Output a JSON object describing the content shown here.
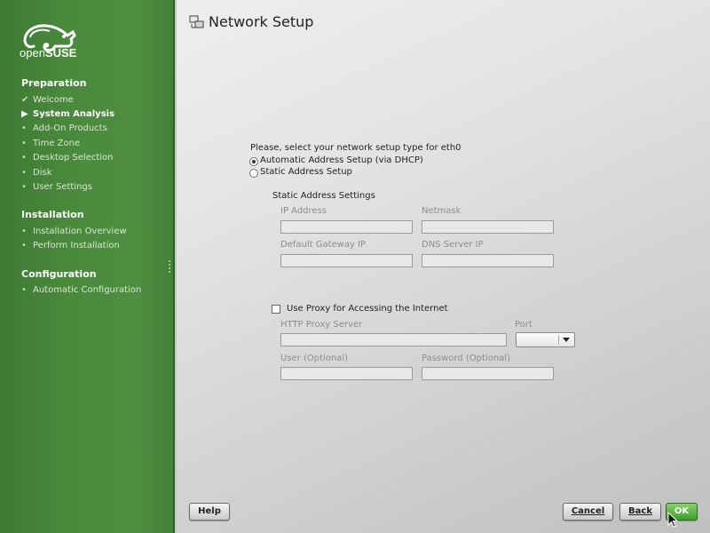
{
  "brand": {
    "logo_text_light": "open",
    "logo_text_bold": "SUSE",
    "logo_color": "#ffffff"
  },
  "sidebar": {
    "sections": [
      {
        "heading": "Preparation",
        "steps": [
          {
            "label": "Welcome",
            "state": "done",
            "mark": "✔"
          },
          {
            "label": "System Analysis",
            "state": "active",
            "mark": "▶"
          },
          {
            "label": "Add-On Products",
            "state": "todo",
            "mark": "•"
          },
          {
            "label": "Time Zone",
            "state": "todo",
            "mark": "•"
          },
          {
            "label": "Desktop Selection",
            "state": "todo",
            "mark": "•"
          },
          {
            "label": "Disk",
            "state": "todo",
            "mark": "•"
          },
          {
            "label": "User Settings",
            "state": "todo",
            "mark": "•"
          }
        ]
      },
      {
        "heading": "Installation",
        "steps": [
          {
            "label": "Installation Overview",
            "state": "todo",
            "mark": "•"
          },
          {
            "label": "Perform Installation",
            "state": "todo",
            "mark": "•"
          }
        ]
      },
      {
        "heading": "Configuration",
        "steps": [
          {
            "label": "Automatic Configuration",
            "state": "todo",
            "mark": "•"
          }
        ]
      }
    ]
  },
  "page": {
    "title": "Network Setup",
    "prompt": "Please, select your network setup type for eth0",
    "options": {
      "automatic": {
        "label": "Automatic Address Setup (via DHCP)",
        "selected": true
      },
      "static": {
        "label": "Static Address Setup",
        "selected": false
      }
    },
    "static_group": {
      "heading": "Static Address Settings",
      "ip_label": "IP Address",
      "netmask_label": "Netmask",
      "gateway_label": "Default Gateway IP",
      "dns_label": "DNS Server IP"
    },
    "proxy": {
      "checkbox_label": "Use Proxy for Accessing the Internet",
      "checked": false,
      "server_label": "HTTP Proxy Server",
      "port_label": "Port",
      "user_label": "User (Optional)",
      "password_label": "Password (Optional)"
    }
  },
  "buttons": {
    "help": "Help",
    "cancel": "Cancel",
    "back": "Back",
    "ok": "OK"
  },
  "colors": {
    "sidebar_green": "#4a8a3c",
    "ok_green": "#3f9b2b",
    "disabled_text": "#8c8c8c"
  }
}
